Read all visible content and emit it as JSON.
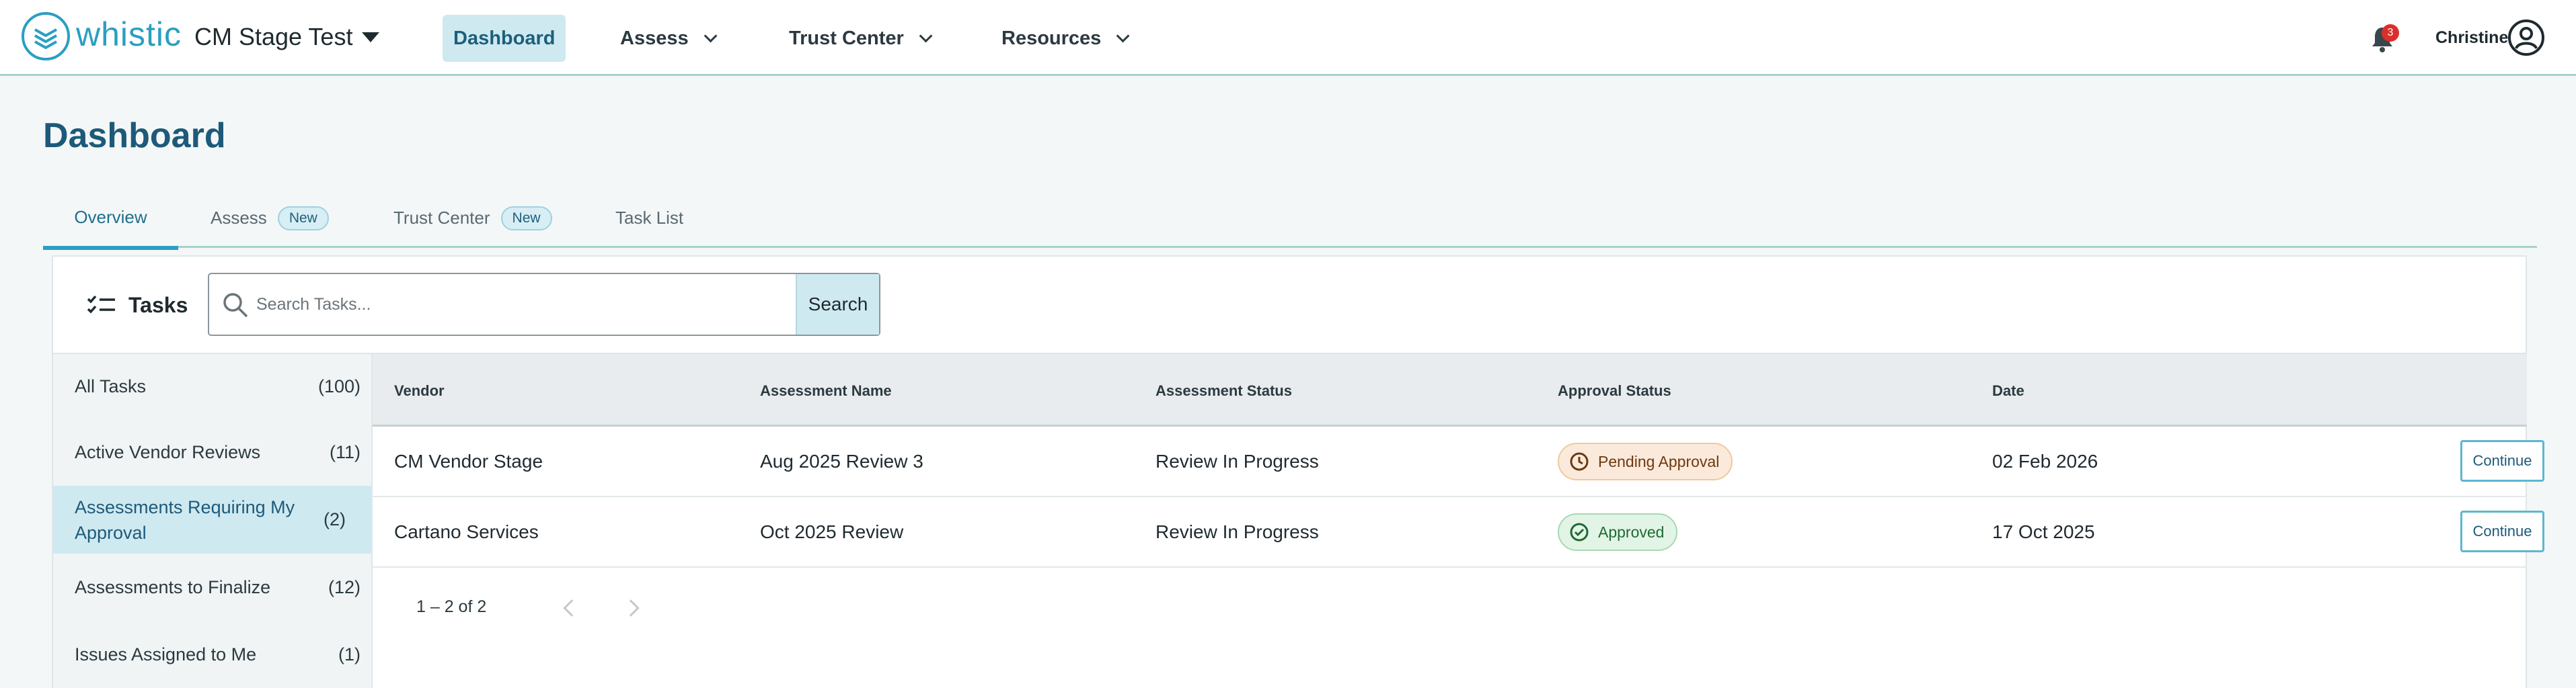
{
  "header": {
    "brand": "whistic",
    "workspace": "CM Stage Test",
    "nav": [
      {
        "label": "Dashboard"
      },
      {
        "label": "Assess"
      },
      {
        "label": "Trust Center"
      },
      {
        "label": "Resources"
      }
    ],
    "notification_count": "3",
    "user_name": "Christine"
  },
  "page": {
    "title": "Dashboard",
    "tabs": [
      {
        "label": "Overview"
      },
      {
        "label": "Assess",
        "badge": "New"
      },
      {
        "label": "Trust Center",
        "badge": "New"
      },
      {
        "label": "Task List"
      }
    ]
  },
  "tasks": {
    "heading": "Tasks",
    "search_placeholder": "Search Tasks...",
    "search_button": "Search",
    "filters": [
      {
        "label": "All Tasks",
        "count": "(100)"
      },
      {
        "label": "Active Vendor Reviews",
        "count": "(11)"
      },
      {
        "label": "Assessments Requiring My Approval",
        "count": "(2)"
      },
      {
        "label": "Assessments to Finalize",
        "count": "(12)"
      },
      {
        "label": "Issues Assigned to Me",
        "count": "(1)"
      }
    ],
    "columns": [
      "Vendor",
      "Assessment Name",
      "Assessment Status",
      "Approval Status",
      "Date"
    ],
    "rows": [
      {
        "vendor": "CM Vendor Stage",
        "assessment": "Aug 2025 Review 3",
        "status": "Review In Progress",
        "approval": "Pending Approval",
        "date": "02 Feb 2026",
        "action": "Continue"
      },
      {
        "vendor": "Cartano Services",
        "assessment": "Oct 2025 Review",
        "status": "Review In Progress",
        "approval": "Approved",
        "date": "17 Oct 2025",
        "action": "Continue"
      }
    ],
    "pagination": "1 – 2 of 2"
  },
  "colors": {
    "brand": "#2a9fc1",
    "title": "#1d5a7a",
    "active_bg": "#cfe9f0",
    "pending": "#fbeadb",
    "approved": "#e2f4e6"
  }
}
